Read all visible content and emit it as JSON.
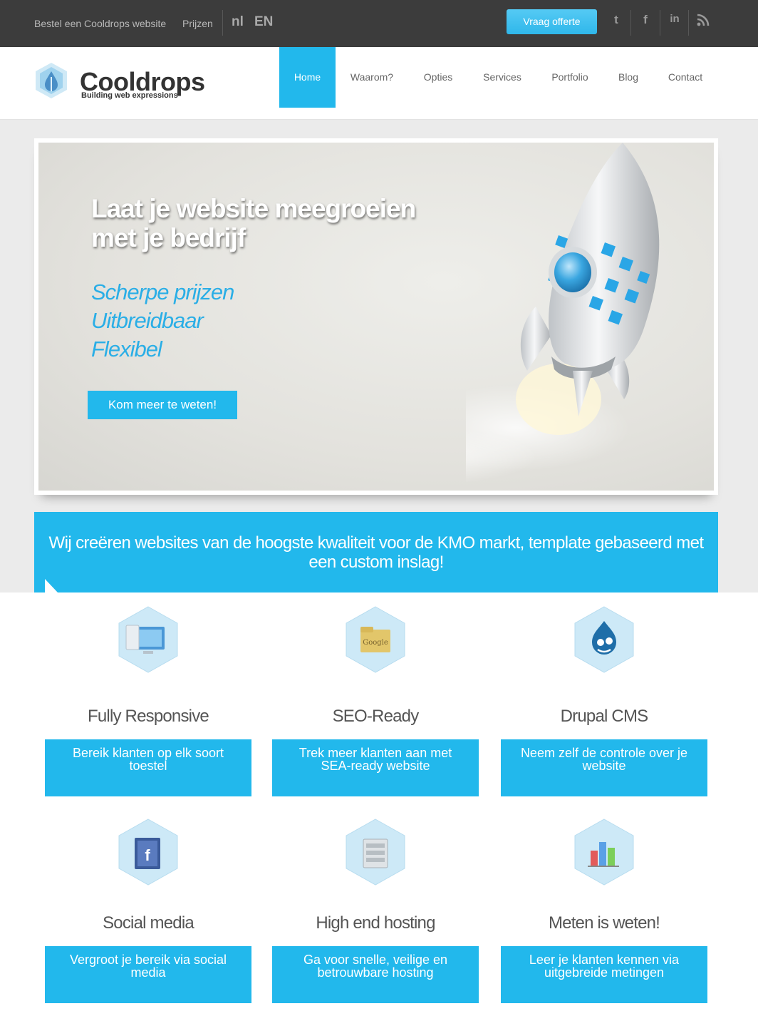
{
  "topbar": {
    "links": [
      "Bestel een Cooldrops website",
      "Prijzen"
    ],
    "languages": [
      "nl",
      "EN"
    ],
    "cta": "Vraag offerte",
    "social_icons": [
      "twitter-icon",
      "facebook-icon",
      "linkedin-icon",
      "rss-icon"
    ]
  },
  "brand": {
    "name": "Cooldrops",
    "tagline": "Building web expressions",
    "accent_color": "#22b8ec"
  },
  "nav": {
    "items": [
      "Home",
      "Waarom?",
      "Opties",
      "Services",
      "Portfolio",
      "Blog",
      "Contact"
    ],
    "active": "Home"
  },
  "hero": {
    "title_line1": "Laat je website meegroeien",
    "title_line2": "met je bedrijf",
    "points": [
      "Scherpe prijzen",
      "Uitbreidbaar",
      "Flexibel"
    ],
    "button": "Kom meer te weten!"
  },
  "band": {
    "text": "Wij creëren websites van de hoogste kwaliteit voor de KMO markt, template gebaseerd met een custom inslag!"
  },
  "features": [
    {
      "icon": "devices-icon",
      "title": "Fully Responsive",
      "text": "Bereik klanten op elk soort toestel"
    },
    {
      "icon": "google-folder-icon",
      "title": "SEO-Ready",
      "text": "Trek meer klanten aan met SEA-ready website"
    },
    {
      "icon": "drupal-icon",
      "title": "Drupal CMS",
      "text": "Neem zelf de controle over je website"
    },
    {
      "icon": "facebook-book-icon",
      "title": "Social media",
      "text": "Vergroot je bereik via social media"
    },
    {
      "icon": "server-icon",
      "title": "High end hosting",
      "text": "Ga voor snelle, veilige en betrouwbare hosting"
    },
    {
      "icon": "bar-chart-icon",
      "title": "Meten is weten!",
      "text": "Leer je klanten kennen via uitgebreide metingen"
    }
  ]
}
